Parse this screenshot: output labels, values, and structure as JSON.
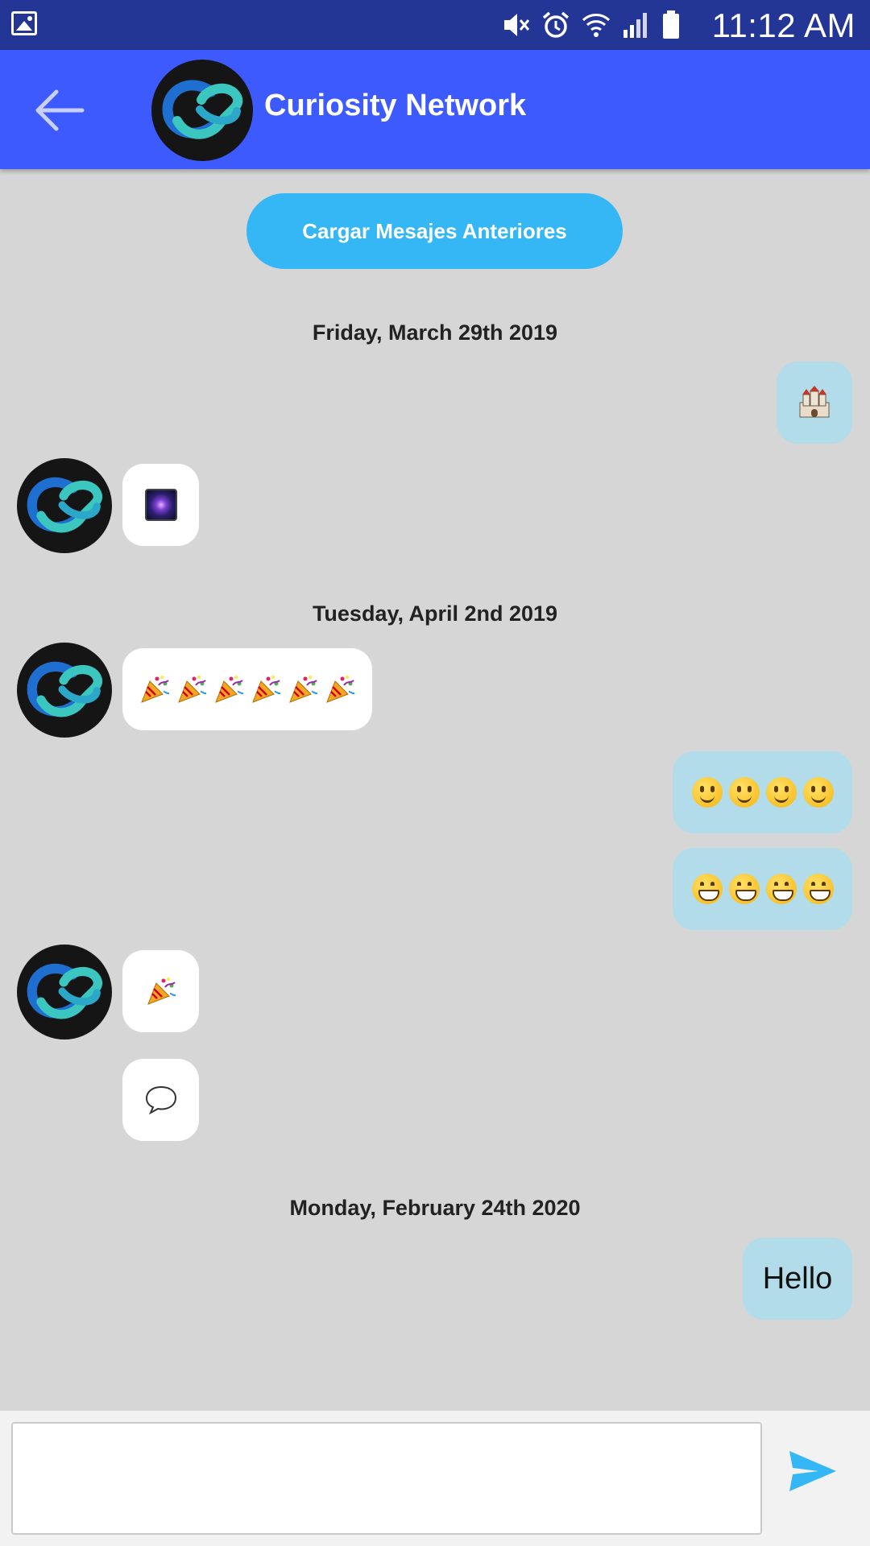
{
  "status_bar": {
    "time": "11:12 AM"
  },
  "header": {
    "title": "Curiosity Network"
  },
  "load_more": {
    "label": "Cargar Mesajes Anteriores"
  },
  "dates": [
    "Friday, March 29th 2019",
    "Tuesday, April 2nd 2019",
    "Monday, February 24th 2020"
  ],
  "messages": [
    {
      "from": "me",
      "content": "castle-emoji"
    },
    {
      "from": "contact",
      "content": "milky-way-emoji"
    },
    {
      "from": "contact",
      "content": "party-popper-emoji x6"
    },
    {
      "from": "me",
      "content": "slightly-smiling-face-emoji x4"
    },
    {
      "from": "me",
      "content": "grinning-face-emoji x4"
    },
    {
      "from": "contact",
      "content": "party-popper-emoji"
    },
    {
      "from": "contact",
      "content": "speech-balloon-emoji"
    },
    {
      "from": "me",
      "text": "Hello"
    }
  ],
  "composer": {
    "value": "",
    "placeholder": ""
  },
  "colors": {
    "status_bar": "#243695",
    "app_bar": "#3d5afe",
    "load_button": "#35b7f6",
    "outgoing_bubble": "#b2dcea",
    "incoming_bubble": "#ffffff",
    "background": "#d6d6d6",
    "send_icon": "#35b7f6"
  },
  "icons": [
    "gallery-icon",
    "mute-icon",
    "alarm-icon",
    "wifi-icon",
    "signal-icon",
    "battery-icon",
    "back-arrow-icon",
    "send-icon"
  ]
}
